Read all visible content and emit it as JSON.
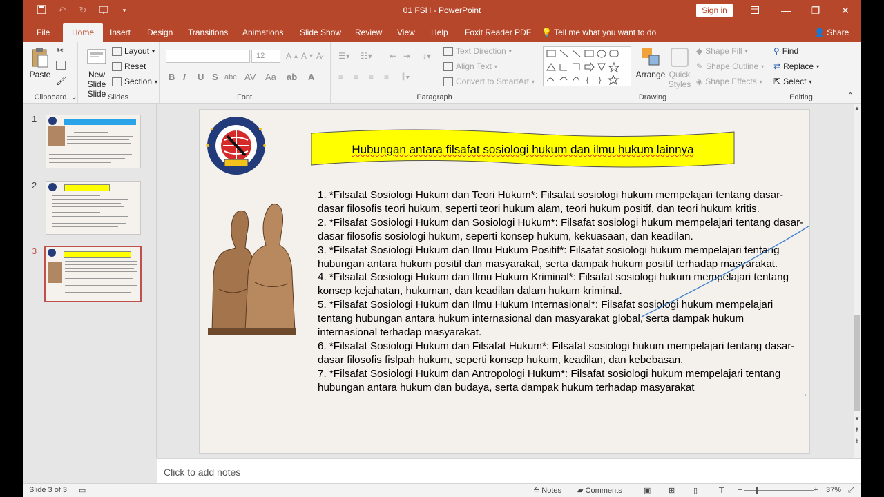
{
  "app": {
    "title": "01 FSH  -  PowerPoint",
    "sign_in": "Sign in",
    "share": "Share",
    "tell_me": "Tell me what you want to do"
  },
  "colors": {
    "accent": "#b7472a",
    "banner": "#ffff00",
    "ink_line": "#3a7fd0"
  },
  "tabs": [
    {
      "label": "File"
    },
    {
      "label": "Home"
    },
    {
      "label": "Insert"
    },
    {
      "label": "Design"
    },
    {
      "label": "Transitions"
    },
    {
      "label": "Animations"
    },
    {
      "label": "Slide Show"
    },
    {
      "label": "Review"
    },
    {
      "label": "View"
    },
    {
      "label": "Help"
    },
    {
      "label": "Foxit Reader PDF"
    }
  ],
  "ribbon": {
    "clipboard": {
      "label": "Clipboard",
      "paste": "Paste"
    },
    "slides": {
      "label": "Slides",
      "new_slide": "New Slide",
      "new_slide_2": "Slide",
      "layout": "Layout",
      "reset": "Reset",
      "section": "Section"
    },
    "font": {
      "label": "Font",
      "size": "12",
      "bold": "B",
      "italic": "I",
      "underline": "U",
      "shadow": "S",
      "strike": "abc"
    },
    "paragraph": {
      "label": "Paragraph",
      "text_direction": "Text Direction",
      "align_text": "Align Text",
      "convert": "Convert to SmartArt"
    },
    "drawing": {
      "label": "Drawing",
      "arrange": "Arrange",
      "quick_styles": "Quick",
      "quick_styles_2": "Styles",
      "shape_fill": "Shape Fill",
      "shape_outline": "Shape Outline",
      "shape_effects": "Shape Effects"
    },
    "editing": {
      "label": "Editing",
      "find": "Find",
      "replace": "Replace",
      "select": "Select"
    }
  },
  "thumbnails": [
    {
      "number": "1"
    },
    {
      "number": "2"
    },
    {
      "number": "3"
    }
  ],
  "slide": {
    "title": "Hubungan antara filsafat sosiologi hukum dan ilmu hukum lainnya",
    "items": [
      "1. *Filsafat Sosiologi Hukum dan Teori Hukum*: Filsafat sosiologi hukum mempelajari tentang dasar-dasar filosofis teori hukum, seperti teori hukum alam, teori hukum positif, dan teori hukum kritis.",
      "2. *Filsafat Sosiologi Hukum dan Sosiologi Hukum*: Filsafat sosiologi hukum mempelajari tentang dasar-dasar filosofis sosiologi hukum, seperti konsep hukum, kekuasaan, dan keadilan.",
      "3. *Filsafat Sosiologi Hukum dan Ilmu Hukum Positif*: Filsafat sosiologi hukum mempelajari tentang hubungan antara hukum positif dan masyarakat, serta dampak hukum positif terhadap masyarakat.",
      "4. *Filsafat Sosiologi Hukum dan Ilmu Hukum Kriminal*: Filsafat sosiologi hukum mempelajari tentang konsep kejahatan, hukuman, dan keadilan dalam hukum kriminal.",
      "5. *Filsafat Sosiologi Hukum dan Ilmu Hukum Internasional*: Filsafat sosiologi hukum mempelajari tentang hubungan antara hukum internasional dan masyarakat global, serta dampak hukum internasional terhadap masyarakat.",
      "6. *Filsafat Sosiologi Hukum dan Filsafat Hukum*: Filsafat sosiologi hukum mempelajari tentang dasar-dasar filosofis fislpah hukum, seperti konsep hukum, keadilan, dan kebebasan.",
      "7. *Filsafat Sosiologi Hukum dan Antropologi Hukum*: Filsafat sosiologi hukum mempelajari tentang hubungan antara hukum dan budaya, serta dampak hukum terhadap masyarakat"
    ]
  },
  "notes_placeholder": "Click to add notes",
  "status": {
    "slide_info": "Slide 3 of 3",
    "notes": "Notes",
    "comments": "Comments",
    "zoom": "37%",
    "zoom_fraction": 0.37
  }
}
